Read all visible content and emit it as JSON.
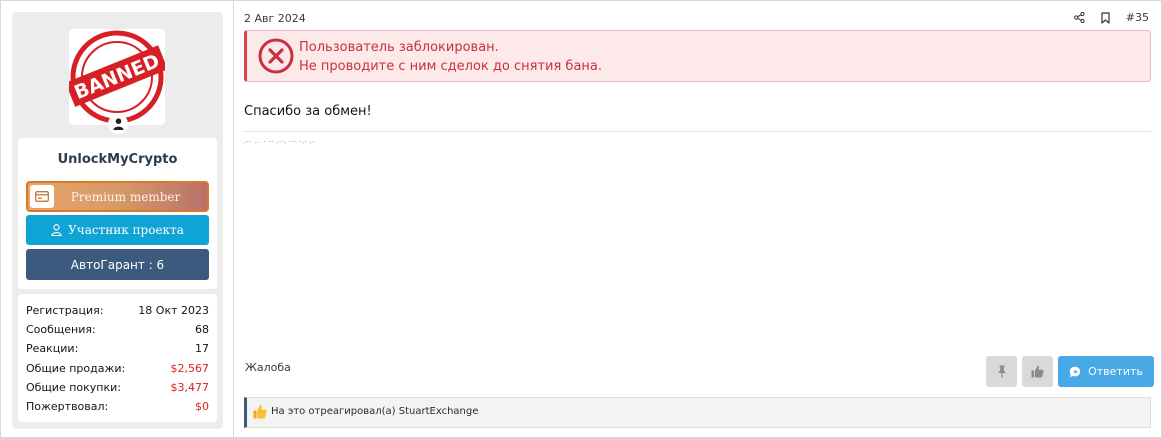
{
  "user": {
    "avatar_text": "BANNED",
    "username": "UnlockMyCrypto",
    "premium_label": "Premium member",
    "member_label": "Участник проекта",
    "garant_label": "АвтоГарант : 6"
  },
  "stats": [
    {
      "label": "Регистрация:",
      "value": "18 Окт 2023",
      "color": "#141414"
    },
    {
      "label": "Сообщения:",
      "value": "68",
      "color": "#141414"
    },
    {
      "label": "Реакции:",
      "value": "17",
      "color": "#141414"
    },
    {
      "label": "Общие продажи:",
      "value": "$2,567",
      "color": "#e02020"
    },
    {
      "label": "Общие покупки:",
      "value": "$3,477",
      "color": "#e02020"
    },
    {
      "label": "Пожертвовал:",
      "value": "$0",
      "color": "#e02020"
    }
  ],
  "post": {
    "date": "2 Авг 2024",
    "number": "#35",
    "ban_line1": "Пользователь заблокирован.",
    "ban_line2": "Не проводите с ним сделок до снятия бана.",
    "message": "Спасибо за обмен!",
    "signature": ",-- ... - -- ,--, --- -,- ,-",
    "report": "Жалоба",
    "reply": "Ответить",
    "reactions": "На это отреагировал(а) StuartExchange"
  },
  "icons": {
    "share": "share-icon",
    "bookmark": "bookmark-icon",
    "ban": "error-circle-icon",
    "pin": "pin-icon",
    "like": "like-icon",
    "reply": "reply-icon",
    "member": "user-icon",
    "premium": "card-icon"
  },
  "colors": {
    "ban_red": "#c6323e",
    "reply_blue": "#47a9e6",
    "member_blue": "#0fa3d6",
    "garant_navy": "#3c5a7d",
    "premium_orange": "#d87a2a"
  }
}
